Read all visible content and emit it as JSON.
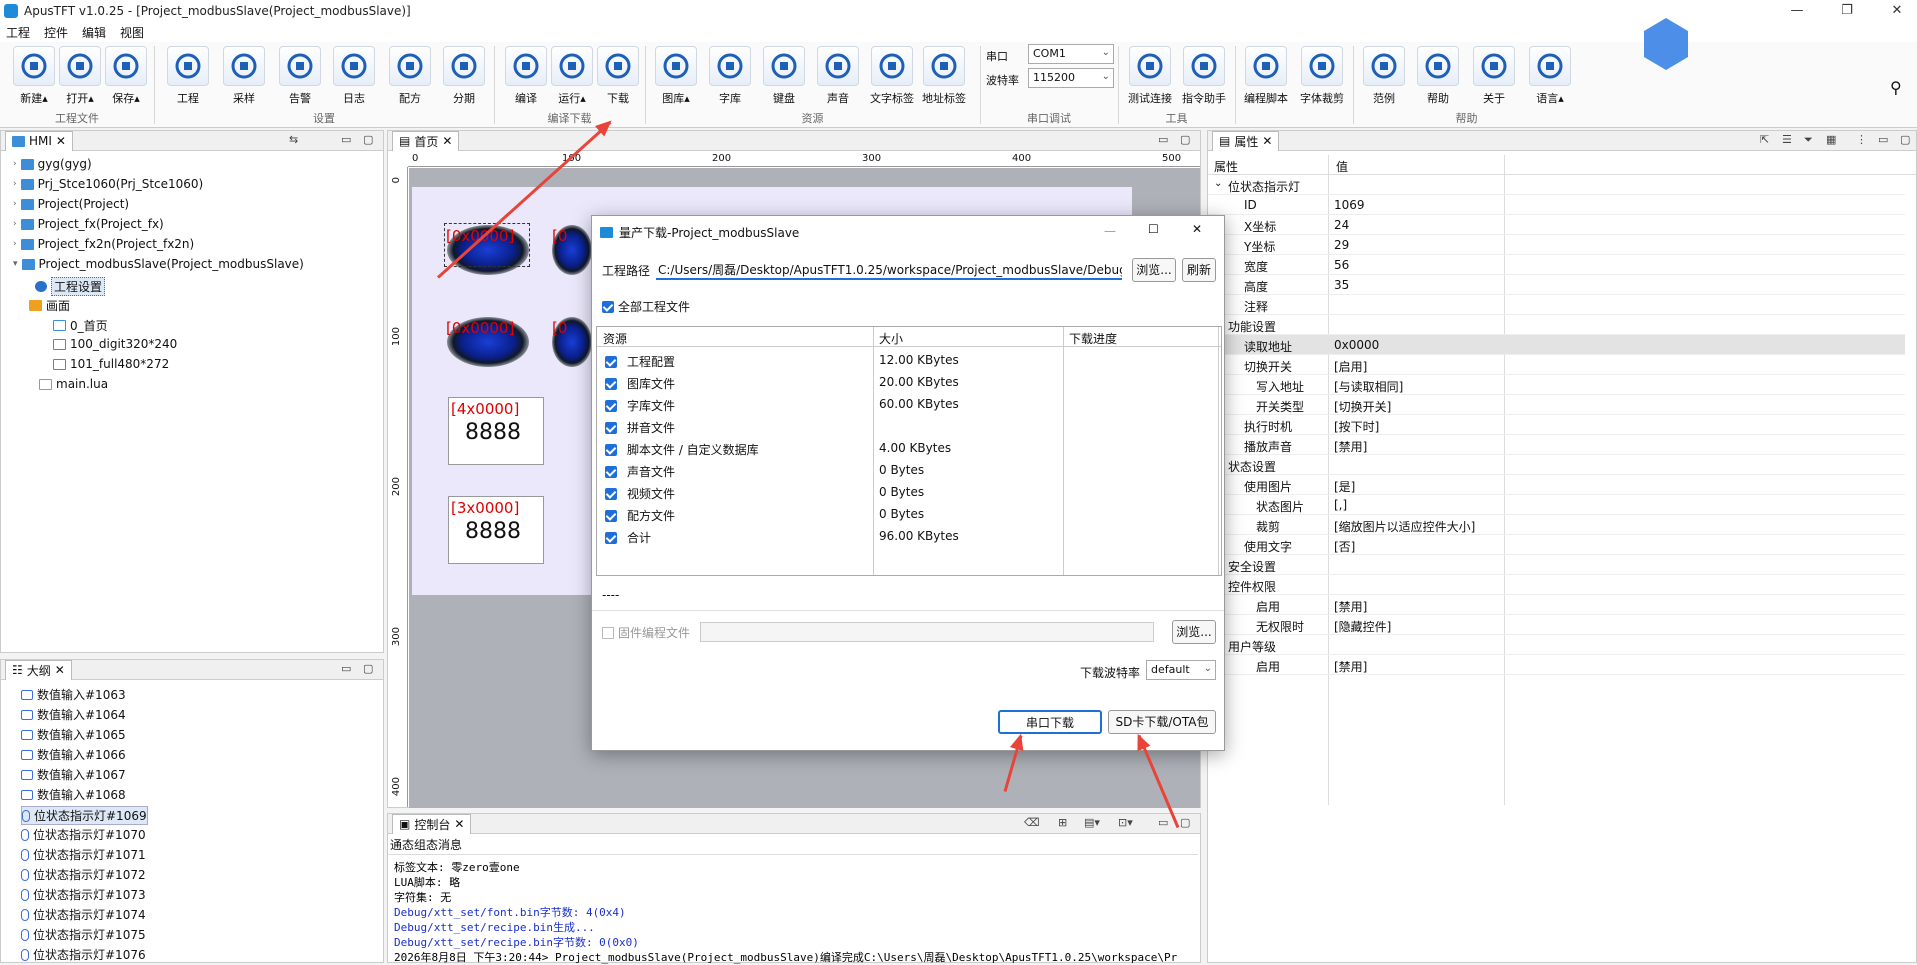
{
  "window": {
    "title": "ApusTFT v1.0.25 - [Project_modbusSlave(Project_modbusSlave)]",
    "controls": [
      "—",
      "❐",
      "✕"
    ]
  },
  "menu": [
    "工程",
    "控件",
    "编辑",
    "视图"
  ],
  "ribbon": {
    "buttons": [
      {
        "label": "新建▴",
        "icon": "new-icon"
      },
      {
        "label": "打开▴",
        "icon": "open-folder-icon"
      },
      {
        "label": "保存▴",
        "icon": "save-icon"
      },
      {
        "label": "工程",
        "icon": "gear-icon"
      },
      {
        "label": "采样",
        "icon": "flask-icon"
      },
      {
        "label": "告警",
        "icon": "bell-icon"
      },
      {
        "label": "日志",
        "icon": "log-icon"
      },
      {
        "label": "配方",
        "icon": "recipe-icon"
      },
      {
        "label": "分期",
        "icon": "installment-icon"
      },
      {
        "label": "编译",
        "icon": "compile-icon"
      },
      {
        "label": "运行▴",
        "icon": "play-icon"
      },
      {
        "label": "下载",
        "icon": "download-icon"
      },
      {
        "label": "图库▴",
        "icon": "image-icon"
      },
      {
        "label": "字库",
        "icon": "font-icon"
      },
      {
        "label": "键盘",
        "icon": "keyboard-icon"
      },
      {
        "label": "声音",
        "icon": "music-icon"
      },
      {
        "label": "文字标签",
        "icon": "tag-icon"
      },
      {
        "label": "地址标签",
        "icon": "address-tag-icon"
      },
      {
        "label": "测试连接",
        "icon": "connect-icon"
      },
      {
        "label": "指令助手",
        "icon": "command-icon"
      },
      {
        "label": "编程脚本",
        "icon": "lua-icon"
      },
      {
        "label": "字体裁剪",
        "icon": "scissors-icon"
      },
      {
        "label": "范例",
        "icon": "bookmark-icon"
      },
      {
        "label": "帮助",
        "icon": "help-icon"
      },
      {
        "label": "关于",
        "icon": "info-icon"
      },
      {
        "label": "语言▴",
        "icon": "globe-icon"
      }
    ],
    "groups": [
      "工程文件",
      "设置",
      "编译下载",
      "资源",
      "串口调试",
      "工具",
      "帮助"
    ],
    "serial": {
      "port_label": "串口",
      "port_value": "COM1",
      "baud_label": "波特率",
      "baud_value": "115200"
    }
  },
  "hmi_panel": {
    "tab": "HMI",
    "items": [
      "gyg(gyg)",
      "Prj_Stce1060(Prj_Stce1060)",
      "Project(Project)",
      "Project_fx(Project_fx)",
      "Project_fx2n(Project_fx2n)",
      "Project_modbusSlave(Project_modbusSlave)",
      "工程设置",
      "画面",
      "0_首页",
      "100_digit320*240",
      "101_full480*272",
      "main.lua"
    ]
  },
  "outline_panel": {
    "tab": "大纲",
    "items": [
      "数值输入#1063",
      "数值输入#1064",
      "数值输入#1065",
      "数值输入#1066",
      "数值输入#1067",
      "数值输入#1068",
      "位状态指示灯#1069",
      "位状态指示灯#1070",
      "位状态指示灯#1071",
      "位状态指示灯#1072",
      "位状态指示灯#1073",
      "位状态指示灯#1074",
      "位状态指示灯#1075",
      "位状态指示灯#1076"
    ]
  },
  "editor": {
    "tab": "首页",
    "ruler_h": [
      "0",
      "100",
      "200",
      "300",
      "400",
      "500"
    ],
    "ruler_v": [
      "0",
      "100",
      "200",
      "300",
      "400"
    ],
    "widgets": {
      "lamp1": "[0x0000]",
      "lamp2": "[0x0000]",
      "num1_addr": "[4x0000]",
      "num1_val": "8888",
      "num2_addr": "[3x0000]",
      "num2_val": "8888",
      "partial1": "[0",
      "partial2": "[0"
    }
  },
  "dialog": {
    "title": "量产下载-Project_modbusSlave",
    "path_label": "工程路径",
    "path_value": "C:/Users/周磊/Desktop/ApusTFT1.0.25/workspace/Project_modbusSlave/Debug/",
    "browse": "浏览...",
    "refresh": "刷新",
    "all_files": "全部工程文件",
    "columns": [
      "资源",
      "大小",
      "下载进度"
    ],
    "rows": [
      {
        "name": "工程配置",
        "size": "12.00 KBytes"
      },
      {
        "name": "图库文件",
        "size": "20.00 KBytes"
      },
      {
        "name": "字库文件",
        "size": "60.00 KBytes"
      },
      {
        "name": "拼音文件",
        "size": ""
      },
      {
        "name": "脚本文件 / 自定义数据库",
        "size": "4.00 KBytes"
      },
      {
        "name": "声音文件",
        "size": "0 Bytes"
      },
      {
        "name": "视频文件",
        "size": "0 Bytes"
      },
      {
        "name": "配方文件",
        "size": "0 Bytes"
      },
      {
        "name": "合计",
        "size": "96.00 KBytes"
      }
    ],
    "status": "----",
    "firmware_label": "固件编程文件",
    "firmware_browse": "浏览...",
    "baud_label": "下载波特率",
    "baud_value": "default",
    "serial_download": "串口下载",
    "sd_download": "SD卡下载/OTA包"
  },
  "properties": {
    "tab": "属性",
    "col_prop": "属性",
    "col_val": "值",
    "rows": [
      {
        "k": "位状态指示灯",
        "v": "",
        "lvl": 0,
        "exp": true
      },
      {
        "k": "ID",
        "v": "1069",
        "lvl": 1
      },
      {
        "k": "X坐标",
        "v": "24",
        "lvl": 1
      },
      {
        "k": "Y坐标",
        "v": "29",
        "lvl": 1
      },
      {
        "k": "宽度",
        "v": "56",
        "lvl": 1
      },
      {
        "k": "高度",
        "v": "35",
        "lvl": 1
      },
      {
        "k": "注释",
        "v": "",
        "lvl": 1
      },
      {
        "k": "功能设置",
        "v": "",
        "lvl": 0
      },
      {
        "k": "读取地址",
        "v": "0x0000",
        "lvl": 1,
        "sel": true
      },
      {
        "k": "切换开关",
        "v": "[启用]",
        "lvl": 1
      },
      {
        "k": "写入地址",
        "v": "[与读取相同]",
        "lvl": 2
      },
      {
        "k": "开关类型",
        "v": "[切换开关]",
        "lvl": 2
      },
      {
        "k": "执行时机",
        "v": "[按下时]",
        "lvl": 1
      },
      {
        "k": "播放声音",
        "v": "[禁用]",
        "lvl": 1
      },
      {
        "k": "状态设置",
        "v": "",
        "lvl": 0
      },
      {
        "k": "使用图片",
        "v": "[是]",
        "lvl": 1
      },
      {
        "k": "状态图片",
        "v": "[,]",
        "lvl": 2
      },
      {
        "k": "裁剪",
        "v": "[缩放图片以适应控件大小]",
        "lvl": 2
      },
      {
        "k": "使用文字",
        "v": "[否]",
        "lvl": 1
      },
      {
        "k": "安全设置",
        "v": "",
        "lvl": 0
      },
      {
        "k": "控件权限",
        "v": "",
        "lvl": 0,
        "exp": true
      },
      {
        "k": "启用",
        "v": "[禁用]",
        "lvl": 2
      },
      {
        "k": "无权限时",
        "v": "[隐藏控件]",
        "lvl": 2
      },
      {
        "k": "用户等级",
        "v": "",
        "lvl": 0,
        "exp": true
      },
      {
        "k": "启用",
        "v": "[禁用]",
        "lvl": 2
      }
    ]
  },
  "console": {
    "tab": "控制台",
    "subtitle": "通态组态消息",
    "lines": [
      {
        "t": "标签文本: 零zero壹one",
        "c": "#000"
      },
      {
        "t": "LUA脚本: 略",
        "c": "#000"
      },
      {
        "t": "字符集: 无",
        "c": "#000"
      },
      {
        "t": "Debug/xtt_set/font.bin字节数: 4(0x4)",
        "c": "#1a2fd0"
      },
      {
        "t": "Debug/xtt_set/recipe.bin生成...",
        "c": "#1a2fd0"
      },
      {
        "t": "Debug/xtt_set/recipe.bin字节数: 0(0x0)",
        "c": "#1a2fd0"
      },
      {
        "t": "2026年8月8日 下午3:20:44> Project_modbusSlave(Project_modbusSlave)编译完成C:\\Users\\周磊\\Desktop\\ApusTFT1.0.25\\workspace\\Pr",
        "c": "#000"
      }
    ]
  },
  "colors": {
    "accent": "#1e6fd8",
    "arrow": "#e8443a",
    "addr_text": "#e00000"
  }
}
